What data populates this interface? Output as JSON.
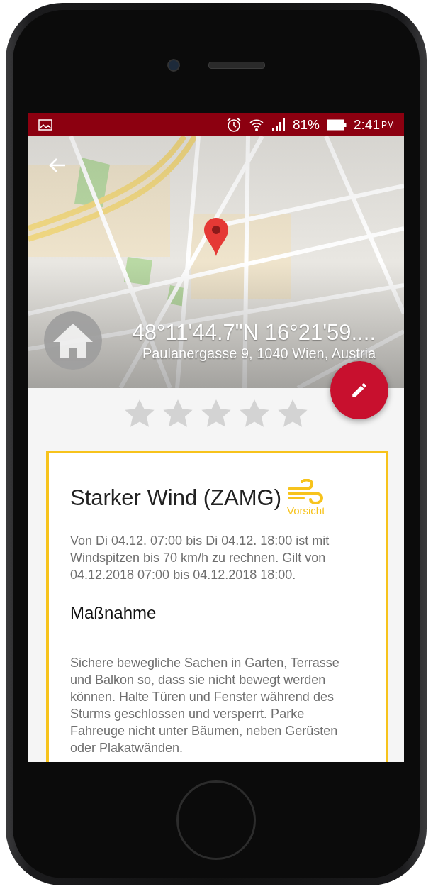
{
  "status_bar": {
    "battery_percent": "81%",
    "time": "2:41",
    "meridiem": "PM"
  },
  "place": {
    "coordinates": "48°11'44.7\"N 16°21'59....",
    "address": "Paulanergasse 9, 1040 Wien, Austria"
  },
  "rating": {
    "stars": 0
  },
  "warning": {
    "title": "Starker Wind (ZAMG)",
    "badge": "Vorsicht",
    "color": "#f7c31c",
    "description": "Von Di 04.12. 07:00 bis Di 04.12. 18:00 ist mit Windspitzen bis 70 km/h zu rechnen. Gilt von 04.12.2018 07:00 bis 04.12.2018 18:00.",
    "measure_heading": "Maßnahme",
    "measure_text": "Sichere bewegliche Sachen in Garten, Terrasse und Balkon so, dass sie nicht bewegt werden können. Halte Türen und Fenster während des Sturms geschlossen und versperrt. Parke Fahreuge nicht unter Bäumen, neben Gerüsten oder Plakatwänden."
  }
}
